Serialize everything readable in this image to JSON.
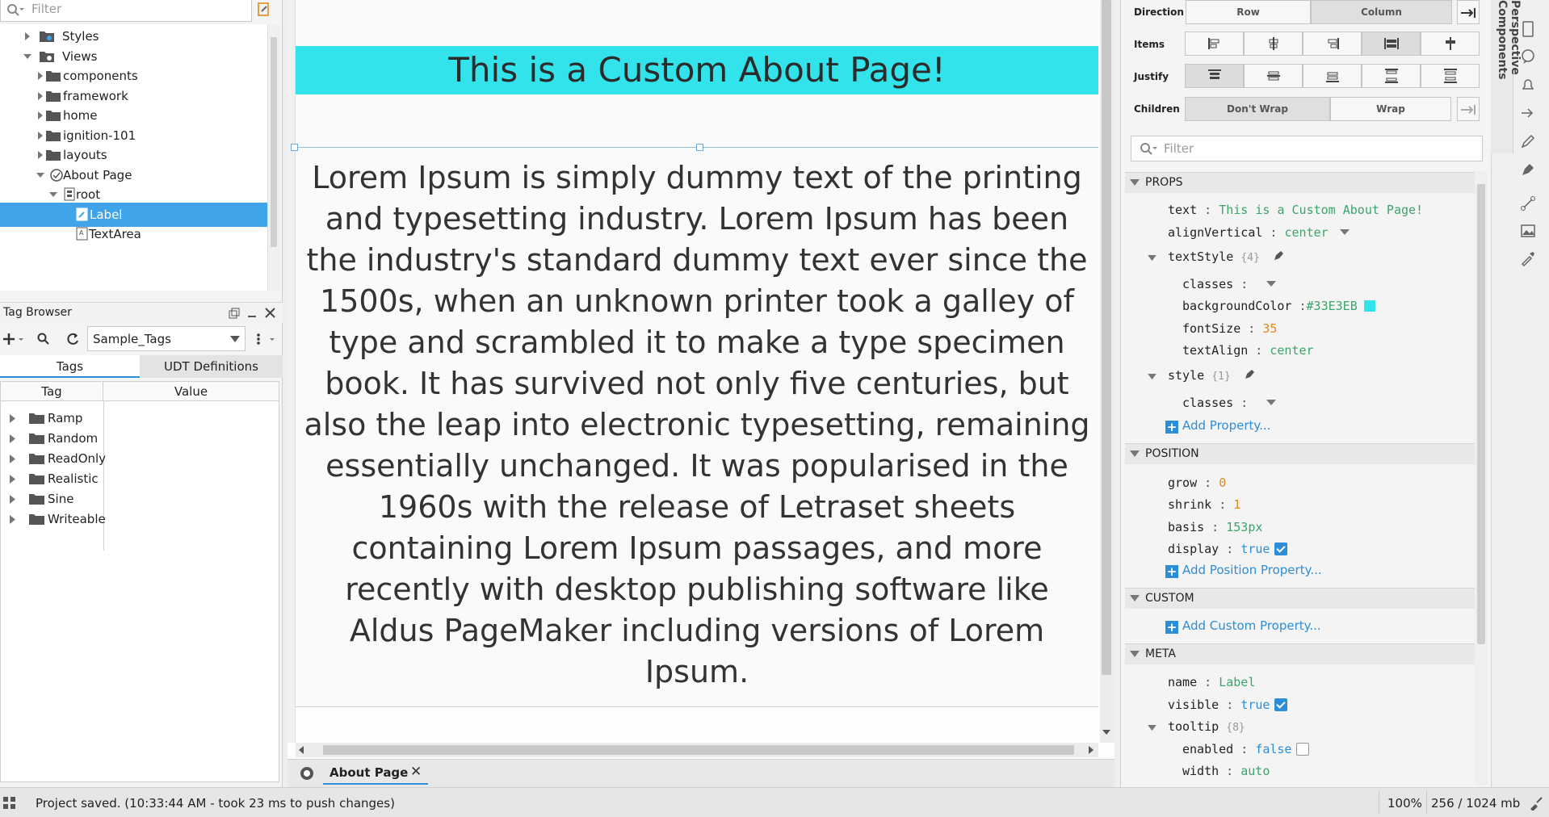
{
  "left_panel": {
    "filter_placeholder": "Filter",
    "tree": [
      {
        "label": "Styles",
        "icon": "styles-folder-icon",
        "expanded": false
      },
      {
        "label": "Views",
        "icon": "views-folder-icon",
        "expanded": true
      },
      {
        "label": "components",
        "icon": "folder-icon",
        "expanded": false
      },
      {
        "label": "framework",
        "icon": "folder-icon",
        "expanded": false
      },
      {
        "label": "home",
        "icon": "folder-icon",
        "expanded": false
      },
      {
        "label": "ignition-101",
        "icon": "folder-icon",
        "expanded": false
      },
      {
        "label": "layouts",
        "icon": "folder-icon",
        "expanded": false
      },
      {
        "label": "About Page",
        "icon": "view-icon",
        "expanded": true
      },
      {
        "label": "root",
        "icon": "flex-container-icon",
        "expanded": true
      },
      {
        "label": "Label",
        "icon": "label-component-icon",
        "selected": true
      },
      {
        "label": "TextArea",
        "icon": "textarea-component-icon"
      }
    ]
  },
  "tag_browser": {
    "title": "Tag Browser",
    "provider": "Sample_Tags",
    "tabs": [
      "Tags",
      "UDT Definitions"
    ],
    "columns": [
      "Tag",
      "Value"
    ],
    "tags": [
      "Ramp",
      "Random",
      "ReadOnly",
      "Realistic",
      "Sine",
      "Writeable"
    ]
  },
  "canvas": {
    "label_text": "This is a Custom About Page!",
    "label_bg": "#33E3EB",
    "textarea_text": "Lorem Ipsum is simply dummy text of the printing and typesetting industry. Lorem Ipsum has been the industry's standard dummy text ever since the 1500s, when an unknown printer took a galley of type and scrambled it to make a type specimen book. It has survived not only five centuries, but also the leap into electronic typesetting, remaining essentially unchanged. It was popularised in the 1960s with the release of Letraset sheets containing Lorem Ipsum passages, and more recently with desktop publishing software like Aldus PageMaker including versions of Lorem Ipsum.",
    "doc_tab": "About Page"
  },
  "property_editor": {
    "direction_label": "Direction",
    "direction_options": [
      "Row",
      "Column"
    ],
    "items_label": "Items",
    "justify_label": "Justify",
    "children_label": "Children",
    "children_options": [
      "Don't Wrap",
      "Wrap"
    ],
    "filter_placeholder": "Filter",
    "sections": {
      "props": "PROPS",
      "position": "POSITION",
      "custom": "CUSTOM",
      "meta": "META"
    },
    "props": {
      "text_key": "text",
      "text_val": "This is a Custom About Page!",
      "alignVertical_key": "alignVertical",
      "alignVertical_val": "center",
      "textStyle_key": "textStyle",
      "textStyle_count": "{4}",
      "classes_key": "classes",
      "backgroundColor_key": "backgroundColor",
      "backgroundColor_val": "#33E3EB",
      "fontSize_key": "fontSize",
      "fontSize_val": "35",
      "textAlign_key": "textAlign",
      "textAlign_val": "center",
      "style_key": "style",
      "style_count": "{1}",
      "style_classes_key": "classes",
      "add_property": "Add Property..."
    },
    "position": {
      "grow_key": "grow",
      "grow_val": "0",
      "shrink_key": "shrink",
      "shrink_val": "1",
      "basis_key": "basis",
      "basis_val": "153px",
      "display_key": "display",
      "display_val": "true",
      "add_position_property": "Add Position Property..."
    },
    "custom": {
      "add_custom_property": "Add Custom Property..."
    },
    "meta": {
      "name_key": "name",
      "name_val": "Label",
      "visible_key": "visible",
      "visible_val": "true",
      "tooltip_key": "tooltip",
      "tooltip_count": "{8}",
      "enabled_key": "enabled",
      "enabled_val": "false",
      "width_key": "width",
      "width_val": "auto"
    }
  },
  "dock": {
    "label": "Perspective Components"
  },
  "status_bar": {
    "message": "Project saved. (10:33:44 AM - took 23 ms to push changes)",
    "zoom": "100%",
    "memory": "256 / 1024 mb"
  },
  "colors": {
    "accent": "#3fa4e8",
    "link": "#2c8ed6",
    "string_value": "#3aa56a",
    "number_value": "#e08a1c"
  }
}
